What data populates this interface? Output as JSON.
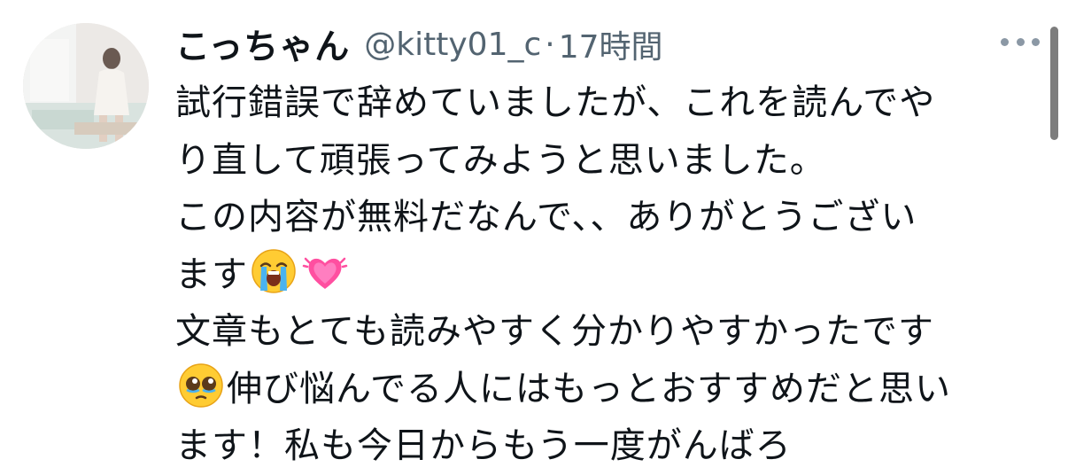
{
  "tweet": {
    "display_name": "こっちゃん",
    "handle": "@kitty01_c",
    "separator": "·",
    "timestamp": "17時間",
    "lines": [
      "試行錯誤で辞めていましたが、これを読んでや",
      "り直して頑張ってみようと思いました。",
      "この内容が無料だなんで、、ありがとうござい",
      "ます",
      "文章もとても読みやすく分かりやすかったです",
      "伸び悩んでる人にはもっとおすすめだと思い",
      "ます！私も今日からもう一度がんばろ"
    ],
    "emojis": [
      "loudly-crying-face",
      "growing-heart",
      "pleading-face"
    ]
  },
  "colors": {
    "text": "#0f1419",
    "secondary": "#536471",
    "more_dots": "#8b98a5",
    "scrollbar": "#7d7d7d"
  }
}
